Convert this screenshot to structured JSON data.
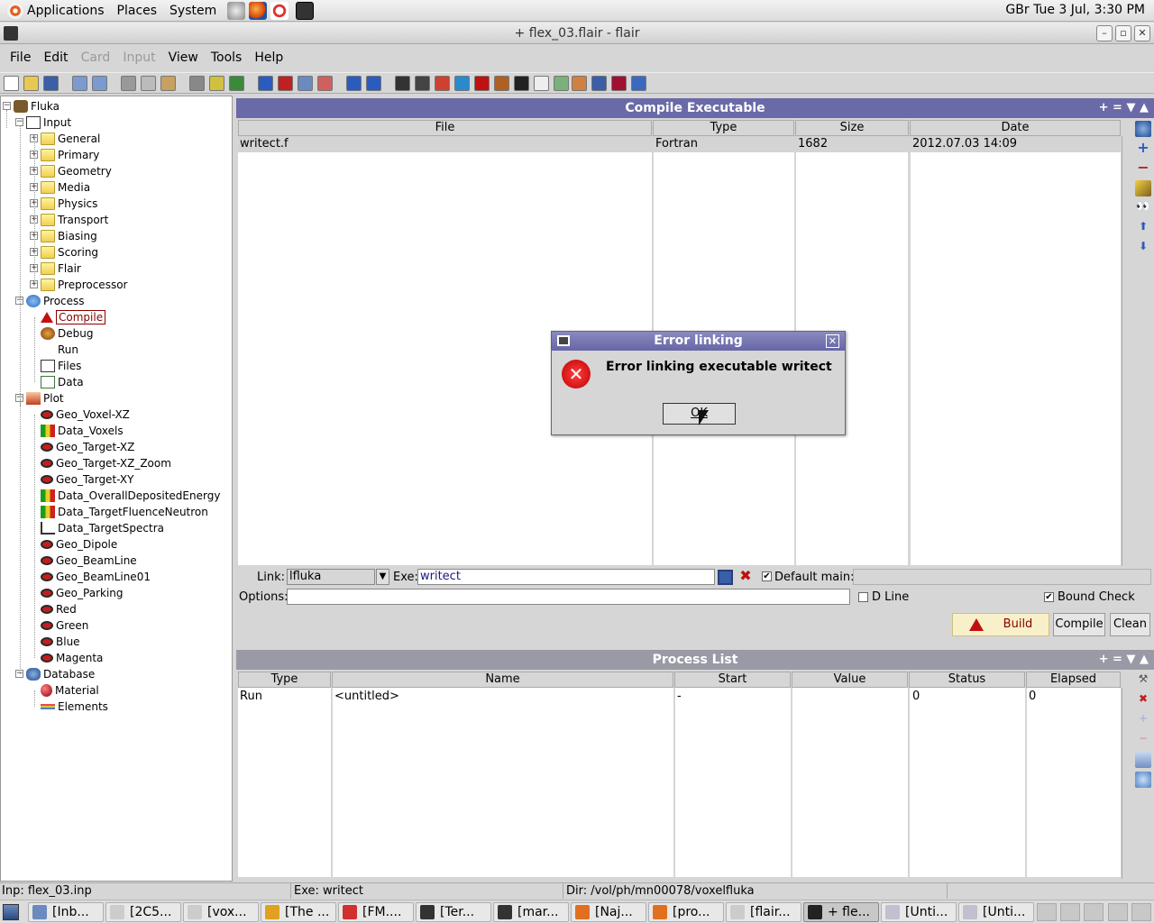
{
  "panel": {
    "menus": [
      "Applications",
      "Places",
      "System"
    ],
    "clock": "GBr Tue  3 Jul,  3:30 PM"
  },
  "window": {
    "title": "+ flex_03.flair - flair"
  },
  "menubar": [
    {
      "label": "File",
      "enabled": true
    },
    {
      "label": "Edit",
      "enabled": true
    },
    {
      "label": "Card",
      "enabled": false
    },
    {
      "label": "Input",
      "enabled": false
    },
    {
      "label": "View",
      "enabled": true
    },
    {
      "label": "Tools",
      "enabled": true
    },
    {
      "label": "Help",
      "enabled": true
    }
  ],
  "tree": {
    "root": "Fluka",
    "input": "Input",
    "input_children": [
      "General",
      "Primary",
      "Geometry",
      "Media",
      "Physics",
      "Transport",
      "Biasing",
      "Scoring",
      "Flair",
      "Preprocessor"
    ],
    "process": "Process",
    "process_children": [
      "Compile",
      "Debug",
      "Run",
      "Files",
      "Data"
    ],
    "plot": "Plot",
    "plot_children": [
      "Geo_Voxel-XZ",
      "Data_Voxels",
      "Geo_Target-XZ",
      "Geo_Target-XZ_Zoom",
      "Geo_Target-XY",
      "Data_OverallDepositedEnergy",
      "Data_TargetFluenceNeutron",
      "Data_TargetSpectra",
      "Geo_Dipole",
      "Geo_BeamLine",
      "Geo_BeamLine01",
      "Geo_Parking",
      "Red",
      "Green",
      "Blue",
      "Magenta"
    ],
    "database": "Database",
    "database_children": [
      "Material",
      "Elements"
    ]
  },
  "compile": {
    "title": "Compile Executable",
    "panel_controls": "+ = ▼ ▲",
    "columns": [
      "File",
      "Type",
      "Size",
      "Date"
    ],
    "rows": [
      {
        "file": "writect.f",
        "type": "Fortran",
        "size": "1682",
        "date": "2012.07.03 14:09"
      }
    ],
    "link_label": "Link:",
    "link_value": "lfluka",
    "exe_label": "Exe:",
    "exe_value": "writect",
    "default_main_label": "Default main:",
    "default_main_checked": true,
    "options_label": "Options:",
    "dline_label": "D Line",
    "dline_checked": false,
    "boundcheck_label": "Bound Check",
    "boundcheck_checked": true,
    "build_label": "Build",
    "compile_label": "Compile",
    "clean_label": "Clean"
  },
  "process_list": {
    "title": "Process List",
    "panel_controls": "+ = ▼ ▲",
    "columns": [
      "Type",
      "Name",
      "Start",
      "Value",
      "Status",
      "Elapsed"
    ],
    "rows": [
      {
        "type": "Run",
        "name": "<untitled>",
        "start": "-",
        "value": "",
        "status": "0",
        "elapsed": "0"
      }
    ]
  },
  "dialog": {
    "title": "Error linking",
    "message": "Error linking executable writect",
    "ok_label": "OK"
  },
  "statusbar": {
    "input": "Inp: flex_03.inp",
    "exe": "Exe: writect",
    "dir": "Dir: /vol/ph/mn00078/voxelfluka"
  },
  "taskbar": [
    {
      "label": "[Inb...",
      "icon": "mail-icon"
    },
    {
      "label": "[2C5...",
      "icon": "window-icon"
    },
    {
      "label": "[vox...",
      "icon": "window-icon"
    },
    {
      "label": "[The ...",
      "icon": "chrome-icon"
    },
    {
      "label": "[FM....",
      "icon": "pdf-icon"
    },
    {
      "label": "[Ter...",
      "icon": "terminal-icon"
    },
    {
      "label": "[mar...",
      "icon": "terminal-icon"
    },
    {
      "label": "[Naj...",
      "icon": "firefox-icon"
    },
    {
      "label": "[pro...",
      "icon": "firefox-icon"
    },
    {
      "label": "[flair...",
      "icon": "window-icon"
    },
    {
      "label": "+ fle...",
      "icon": "flair-icon",
      "active": true
    },
    {
      "label": "[Unti...",
      "icon": "paint-icon"
    },
    {
      "label": "[Unti...",
      "icon": "paint-icon"
    }
  ]
}
